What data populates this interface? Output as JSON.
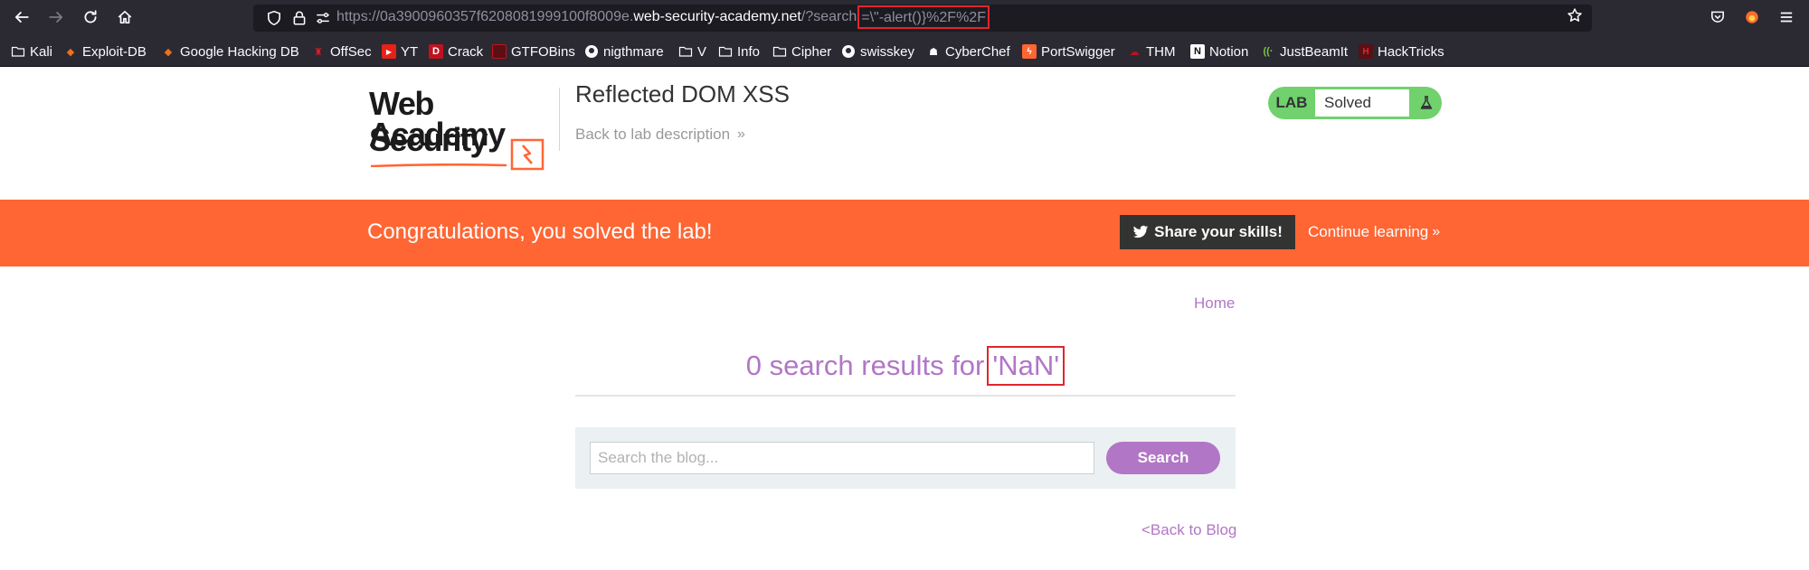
{
  "browser": {
    "url_prefix": "https://0a3900960357f6208081999100f8009e.",
    "url_domain": "web-security-academy.net",
    "url_path": "/?search",
    "url_highlight": "=\\\"-alert()}%2F%2F"
  },
  "bookmarks": [
    {
      "label": "Kali",
      "icon": "folder-icon"
    },
    {
      "label": "Exploit-DB",
      "icon": "exploitdb-icon"
    },
    {
      "label": "Google Hacking DB",
      "icon": "ghdb-icon"
    },
    {
      "label": "OffSec",
      "icon": "offsec-icon"
    },
    {
      "label": "YT",
      "icon": "youtube-icon"
    },
    {
      "label": "Crack",
      "icon": "crack-icon"
    },
    {
      "label": "GTFOBins",
      "icon": "gtfobins-icon"
    },
    {
      "label": "nigthmare",
      "icon": "github-icon"
    },
    {
      "label": "V",
      "icon": "folder-icon"
    },
    {
      "label": "Info",
      "icon": "folder-icon"
    },
    {
      "label": "Cipher",
      "icon": "folder-icon"
    },
    {
      "label": "swisskey",
      "icon": "github-icon"
    },
    {
      "label": "CyberChef",
      "icon": "cyberchef-icon"
    },
    {
      "label": "PortSwigger",
      "icon": "portswigger-icon"
    },
    {
      "label": "THM",
      "icon": "thm-icon"
    },
    {
      "label": "Notion",
      "icon": "notion-icon"
    },
    {
      "label": "JustBeamIt",
      "icon": "justbeamit-icon"
    },
    {
      "label": "HackTricks",
      "icon": "hacktricks-icon"
    }
  ],
  "header": {
    "logo_line1": "Web Security",
    "logo_line2": "Academy",
    "lab_title": "Reflected DOM XSS",
    "back_to_description": "Back to lab description",
    "lab_badge_label": "LAB",
    "lab_status": "Solved"
  },
  "banner": {
    "message": "Congratulations, you solved the lab!",
    "share_label": "Share your skills!",
    "continue_label": "Continue learning"
  },
  "main": {
    "home_link": "Home",
    "results_prefix": "0 search results for",
    "results_term": "'NaN'",
    "search_placeholder": "Search the blog...",
    "search_button": "Search",
    "back_to_blog": "<Back to Blog"
  },
  "colors": {
    "accent": "#ff6633",
    "link": "#b176c6",
    "lab_solved": "#70d16d",
    "highlight_box": "#e0262e"
  }
}
